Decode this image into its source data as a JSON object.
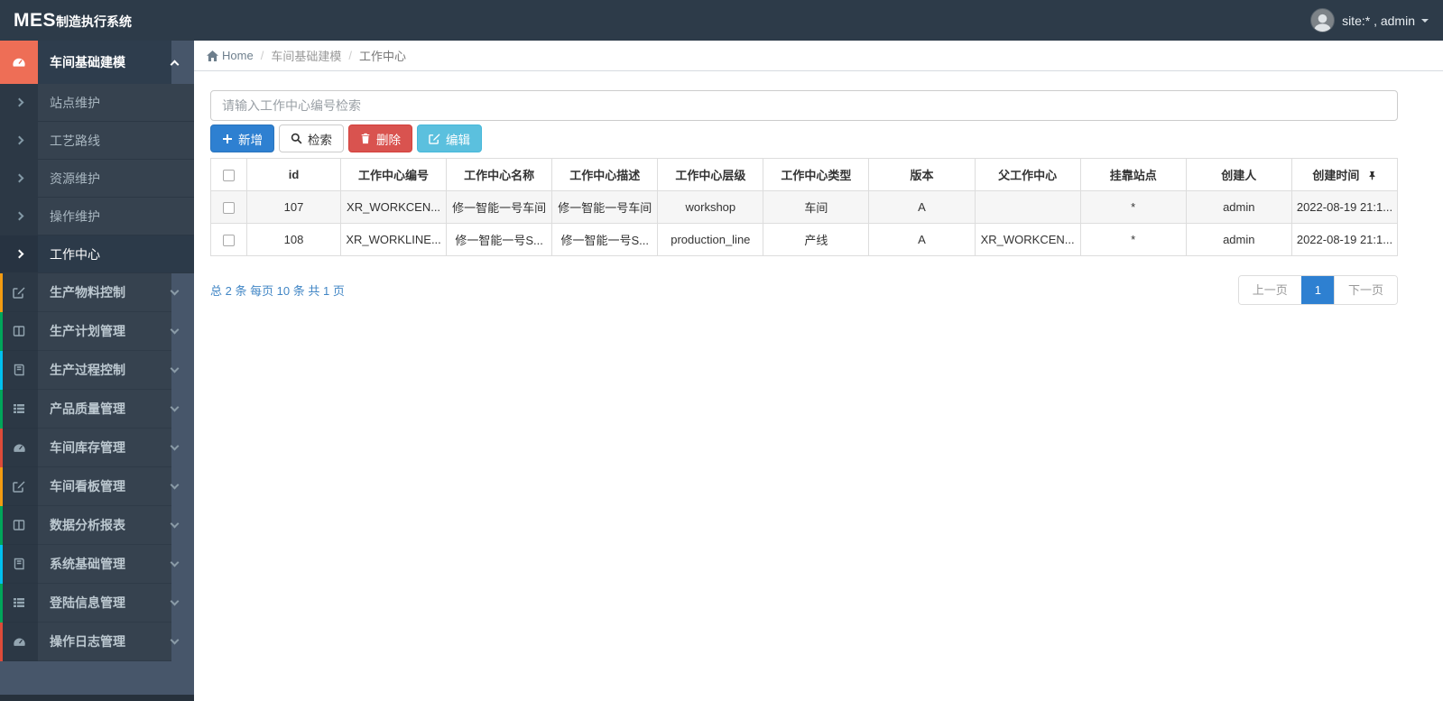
{
  "topbar": {
    "logo_bold": "MES",
    "logo_rest": "制造执行系统",
    "user_label": "site:* , admin"
  },
  "breadcrumb": {
    "home": "Home",
    "sep": "/",
    "level1": "车间基础建模",
    "level2": "工作中心"
  },
  "sidebar": {
    "group_active": {
      "label": "车间基础建模",
      "icon": "dashboard-icon",
      "icon_bg": "#ee6e56"
    },
    "sub_items": [
      {
        "label": "站点维护"
      },
      {
        "label": "工艺路线"
      },
      {
        "label": "资源维护"
      },
      {
        "label": "操作维护"
      },
      {
        "label": "工作中心",
        "active": true
      }
    ],
    "groups": [
      {
        "label": "生产物料控制",
        "icon": "edit-icon",
        "strip": "#f39c12"
      },
      {
        "label": "生产计划管理",
        "icon": "columns-icon",
        "strip": "#00a65a"
      },
      {
        "label": "生产过程控制",
        "icon": "book-icon",
        "strip": "#00c0ef"
      },
      {
        "label": "产品质量管理",
        "icon": "list-icon",
        "strip": "#00a65a"
      },
      {
        "label": "车间库存管理",
        "icon": "dashboard-icon",
        "strip": "#dd4b39"
      },
      {
        "label": "车间看板管理",
        "icon": "edit-icon",
        "strip": "#f39c12"
      },
      {
        "label": "数据分析报表",
        "icon": "columns-icon",
        "strip": "#00a65a"
      },
      {
        "label": "系统基础管理",
        "icon": "book-icon",
        "strip": "#00c0ef"
      },
      {
        "label": "登陆信息管理",
        "icon": "list-icon",
        "strip": "#00a65a"
      },
      {
        "label": "操作日志管理",
        "icon": "dashboard-icon",
        "strip": "#dd4b39"
      }
    ]
  },
  "search": {
    "placeholder": "请输入工作中心编号检索",
    "value": ""
  },
  "toolbar": {
    "add": {
      "label": "新增",
      "icon": "plus-icon"
    },
    "search": {
      "label": "检索",
      "icon": "search-icon"
    },
    "delete": {
      "label": "删除",
      "icon": "trash-icon"
    },
    "edit": {
      "label": "编辑",
      "icon": "edit-icon"
    }
  },
  "table": {
    "columns": [
      "id",
      "工作中心编号",
      "工作中心名称",
      "工作中心描述",
      "工作中心层级",
      "工作中心类型",
      "版本",
      "父工作中心",
      "挂靠站点",
      "创建人",
      "创建时间"
    ],
    "rows": [
      {
        "cells": [
          "107",
          "XR_WORKCEN...",
          "修一智能一号车间",
          "修一智能一号车间",
          "workshop",
          "车间",
          "A",
          "",
          "*",
          "admin",
          "2022-08-19 21:1..."
        ]
      },
      {
        "cells": [
          "108",
          "XR_WORKLINE...",
          "修一智能一号S...",
          "修一智能一号S...",
          "production_line",
          "产线",
          "A",
          "XR_WORKCEN...",
          "*",
          "admin",
          "2022-08-19 21:1..."
        ]
      }
    ]
  },
  "pagination": {
    "summary": "总 2 条 每页 10 条 共 1 页",
    "prev": "上一页",
    "current": "1",
    "next": "下一页"
  },
  "colors": {
    "topbar_bg": "#2d3b49",
    "sidebar_bg": "#36424f",
    "sidebar_icon_col": "#2c3845",
    "active_group_icon_bg": "#ee6e56",
    "accent_blue": "#2e80d1",
    "danger_red": "#d9534f",
    "info_cyan": "#5bc0de",
    "strip_yellow": "#f39c12",
    "strip_green": "#00a65a",
    "strip_aqua": "#00c0ef",
    "strip_red": "#dd4b39"
  }
}
